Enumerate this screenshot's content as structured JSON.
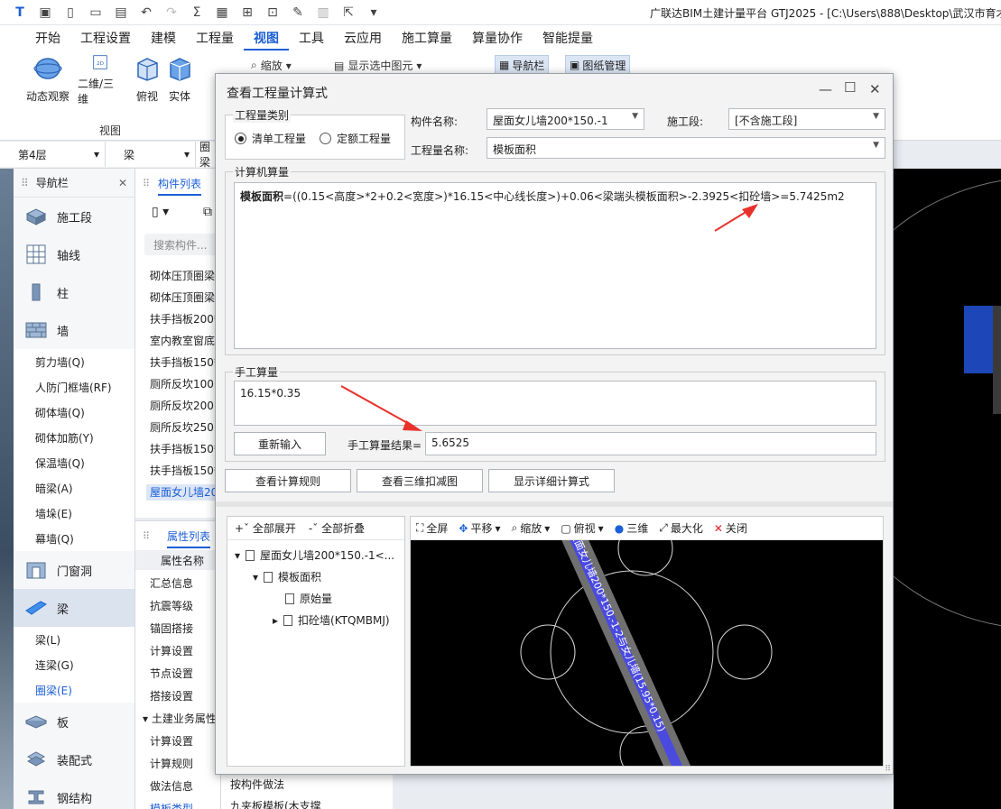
{
  "app": {
    "title": "广联达BIM土建计量平台 GTJ2025 - [C:\\Users\\888\\Desktop\\武汉市育才"
  },
  "menu": [
    "开始",
    "工程设置",
    "建模",
    "工程量",
    "视图",
    "工具",
    "云应用",
    "施工算量",
    "算量协作",
    "智能提量"
  ],
  "ribbon": {
    "buttons": [
      "动态观察",
      "二维/三维",
      "俯视",
      "实体"
    ],
    "icon_2d_text": "2D",
    "group_label": "视图",
    "zoom_label": "缩放",
    "show_selected_label": "显示选中图元",
    "nav_toggle_label": "导航栏",
    "drawing_mgmt_label": "图纸管理"
  },
  "floor": {
    "floor": "第4层",
    "type": "梁",
    "sub": "圈梁"
  },
  "nav": {
    "title": "导航栏",
    "categories_top": [
      "施工段",
      "轴线",
      "柱",
      "墙"
    ],
    "wall_items": [
      "剪力墙(Q)",
      "人防门框墙(RF)",
      "砌体墙(Q)",
      "砌体加筋(Y)",
      "保温墙(Q)",
      "暗梁(A)",
      "墙垛(E)",
      "幕墙(Q)"
    ],
    "door_window": "门窗洞",
    "beam": "梁",
    "beam_items": [
      "梁(L)",
      "连梁(G)",
      "圈梁(E)"
    ],
    "categories_bottom": [
      "板",
      "装配式",
      "钢结构"
    ]
  },
  "component_list": {
    "tab": "构件列表",
    "search_placeholder": "搜索构件...",
    "rows": [
      "砌体压顶圈梁",
      "砌体压顶圈梁",
      "扶手挡板200*",
      "室内教室窗底",
      "扶手挡板150*",
      "厕所反坎100",
      "厕所反坎200",
      "厕所反坎250",
      "扶手挡板150*",
      "扶手挡板150*",
      "屋面女儿墙200"
    ]
  },
  "properties": {
    "tab": "属性列表",
    "header": "属性名称",
    "rows": [
      "汇总信息",
      "抗震等级",
      "锚固搭接",
      "计算设置",
      "节点设置",
      "搭接设置",
      "土建业务属性",
      "计算设置",
      "计算规则",
      "做法信息",
      "模板类型"
    ],
    "values": [
      "按构件做法",
      "九夹板模板(木支撑"
    ]
  },
  "dialog": {
    "title": "查看工程量计算式",
    "qty_category_label": "工程量类别",
    "radio_bill": "清单工程量",
    "radio_quota": "定额工程量",
    "component_name_label": "构件名称:",
    "component_name": "屋面女儿墙200*150.-1",
    "section_label": "施工段:",
    "section": "[不含施工段]",
    "qty_name_label": "工程量名称:",
    "qty_name": "模板面积",
    "computer_calc_label": "计算机算量",
    "formula_bold": "模板面积",
    "formula_rest": "=((0.15<高度>*2+0.2<宽度>)*16.15<中心线长度>)+0.06<梁端头模板面积>-2.3925<扣砼墙>=5.7425m2",
    "manual_calc_label": "手工算量",
    "manual_expr": "16.15*0.35",
    "reinput_label": "重新输入",
    "manual_result_label": "手工算量结果=",
    "manual_result": "5.6525",
    "btn_rules": "查看计算规则",
    "btn_3d": "查看三维扣减图",
    "btn_detail": "显示详细计算式"
  },
  "tree": {
    "expand_all": "全部展开",
    "collapse_all": "全部折叠",
    "root": "屋面女儿墙200*150.-1<...",
    "level1": "模板面积",
    "child1": "原始量",
    "child2": "扣砼墙(KTQMBMJ)"
  },
  "viewer": {
    "toolbar": [
      "全屏",
      "平移",
      "缩放",
      "俯视",
      "三维",
      "最大化",
      "关闭"
    ],
    "wall_label": "屋面女儿墙200*150.-1-2与女儿墙(15.95*0.15)"
  },
  "colors": {
    "accent": "#1c5fd6",
    "arrow": "#e8322c",
    "wall_fill": "#4a4adf"
  }
}
